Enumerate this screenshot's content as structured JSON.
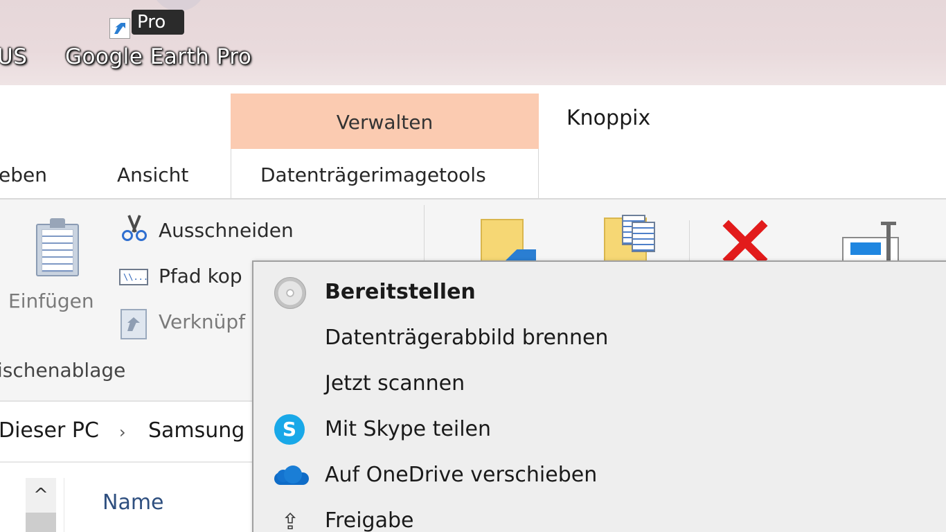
{
  "desktop": {
    "badge_text": "Pro",
    "icon_left_label": "US",
    "icon_google_earth_label": "Google Earth Pro"
  },
  "ribbon": {
    "context_header": "Verwalten",
    "window_title": "Knoppix",
    "tabs": {
      "freigeben_partial": "eben",
      "ansicht": "Ansicht",
      "disk_image_tools": "Datenträgerimagetools"
    },
    "clipboard": {
      "paste": "Einfügen",
      "cut": "Ausschneiden",
      "copy_path": "Pfad kop",
      "paste_shortcut": "Verknüpf",
      "group_label": "ischenablage",
      "path_icon_text": "\\\\..."
    }
  },
  "address": {
    "crumb_pc": "Dieser PC",
    "separator": "›",
    "crumb_drive": "Samsung"
  },
  "list": {
    "scroll_up": "^",
    "column_name": "Name"
  },
  "context_menu": {
    "items": [
      {
        "label": "Bereitstellen",
        "icon": "disc-icon",
        "bold": true
      },
      {
        "label": "Datenträgerabbild brennen",
        "icon": ""
      },
      {
        "label": "Jetzt scannen",
        "icon": ""
      },
      {
        "label": "Mit Skype teilen",
        "icon": "skype-icon"
      },
      {
        "label": "Auf OneDrive verschieben",
        "icon": "onedrive-icon"
      },
      {
        "label": "Freigabe",
        "icon": "share-icon"
      }
    ],
    "skype_glyph": "S",
    "share_glyph": "⇪"
  },
  "colors": {
    "context_tab": "#fbcbb1",
    "delete": "#e21b1b",
    "skype": "#19a8e8",
    "onedrive": "#0f6cc7"
  }
}
